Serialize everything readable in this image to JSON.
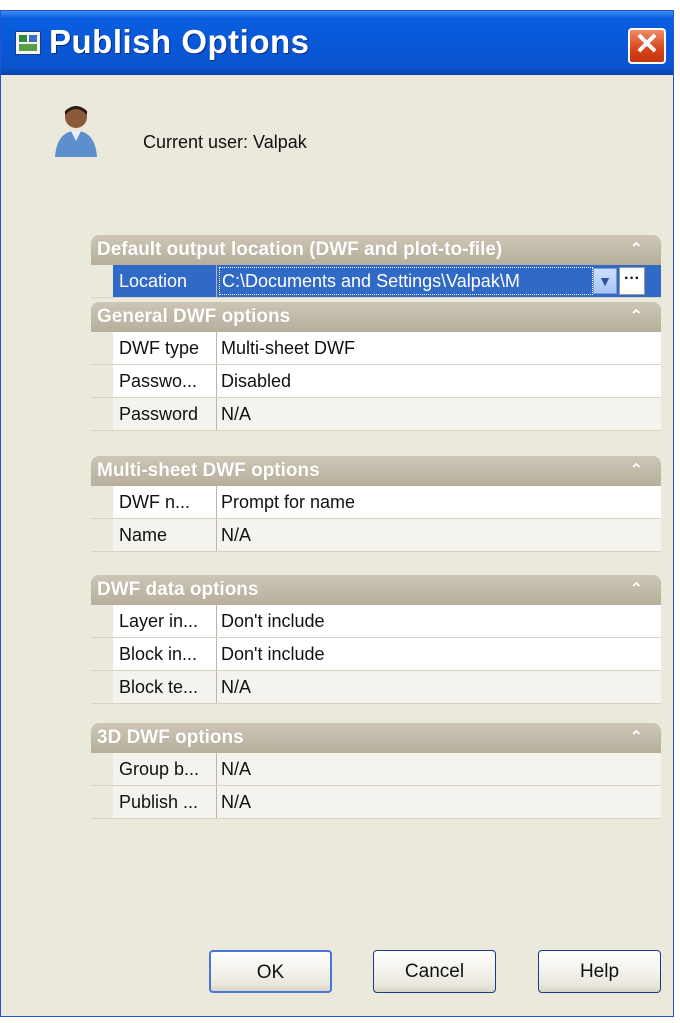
{
  "window": {
    "title": "Publish Options",
    "close_icon": "close-icon",
    "app_icon": "publish-app-icon"
  },
  "user": {
    "label": "Current user: Valpak",
    "icon": "user-icon"
  },
  "sections": {
    "output": {
      "header": "Default output location (DWF and plot-to-file)",
      "rows": [
        {
          "name": "Location",
          "value": "C:\\Documents and Settings\\Valpak\\M"
        }
      ]
    },
    "general": {
      "header": "General DWF options",
      "rows": [
        {
          "name": "DWF type",
          "value": "Multi-sheet DWF"
        },
        {
          "name": "Passwo...",
          "value": "Disabled"
        },
        {
          "name": "Password",
          "value": "N/A"
        }
      ]
    },
    "multisheet": {
      "header": "Multi-sheet DWF options",
      "rows": [
        {
          "name": "DWF n...",
          "value": "Prompt for name"
        },
        {
          "name": "Name",
          "value": "N/A"
        }
      ]
    },
    "data": {
      "header": "DWF data options",
      "rows": [
        {
          "name": "Layer in...",
          "value": "Don't include"
        },
        {
          "name": "Block in...",
          "value": "Don't include"
        },
        {
          "name": "Block te...",
          "value": "N/A"
        }
      ]
    },
    "threed": {
      "header": "3D DWF options",
      "rows": [
        {
          "name": "Group b...",
          "value": "N/A"
        },
        {
          "name": "Publish ...",
          "value": "N/A"
        }
      ]
    }
  },
  "buttons": {
    "ok": "OK",
    "cancel": "Cancel",
    "help": "Help"
  },
  "colors": {
    "title_bar": "#0757d6",
    "selection": "#3169c6",
    "section_header": "#b7af9c",
    "close_button": "#d8431a"
  }
}
